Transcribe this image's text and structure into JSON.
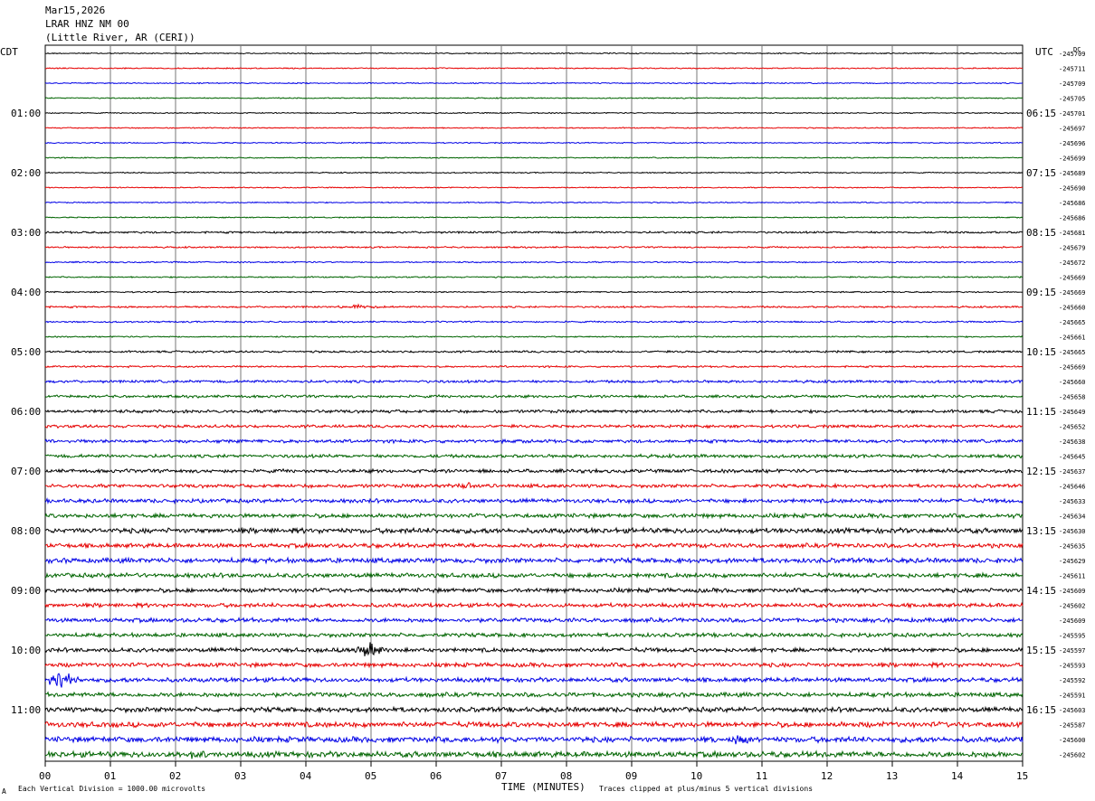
{
  "header": {
    "date": "Mar15,2026",
    "station": "LRAR HNZ NM 00",
    "location": "(Little River, AR (CERI))"
  },
  "axis": {
    "left_tz": "CDT",
    "right_tz": "UTC",
    "dc_label": "DC",
    "xlabel": "TIME (MINUTES)",
    "xticks": [
      "00",
      "01",
      "02",
      "03",
      "04",
      "05",
      "06",
      "07",
      "08",
      "09",
      "10",
      "11",
      "12",
      "13",
      "14",
      "15"
    ]
  },
  "footer": {
    "scale_note": "Each Vertical Division = 1000.00 microvolts",
    "clip_note": "Traces clipped at plus/minus 5 vertical divisions",
    "corner_mark": "A"
  },
  "chart_data": {
    "type": "line",
    "title": "",
    "xlabel": "TIME (MINUTES)",
    "ylabel": "",
    "xlim": [
      0,
      15
    ],
    "trace_colors": [
      "#000000",
      "#e60000",
      "#0000e6",
      "#006400"
    ],
    "rows_per_hour": 4,
    "left_hour_labels": [
      "01:00",
      "02:00",
      "03:00",
      "04:00",
      "05:00",
      "06:00",
      "07:00",
      "08:00",
      "09:00",
      "10:00",
      "11:00"
    ],
    "right_hour_labels": [
      "06:15",
      "07:15",
      "08:15",
      "09:15",
      "10:15",
      "11:15",
      "12:15",
      "13:15",
      "14:15",
      "15:15",
      "16:15"
    ],
    "dc_offsets": [
      -245709,
      -245711,
      -245709,
      -245705,
      -245701,
      -245697,
      -245696,
      -245699,
      -245689,
      -245690,
      -245686,
      -245686,
      -245681,
      -245679,
      -245672,
      -245669,
      -245669,
      -245660,
      -245665,
      -245661,
      -245665,
      -245669,
      -245660,
      -245658,
      -245649,
      -245652,
      -245638,
      -245645,
      -245637,
      -245646,
      -245633,
      -245634,
      -245630,
      -245635,
      -245629,
      -245611,
      -245609,
      -245602,
      -245609,
      -245595,
      -245597,
      -245593,
      -245592,
      -245591,
      -245603,
      -245587,
      -245600,
      -245602
    ],
    "row_noise": [
      0.5,
      0.5,
      0.5,
      0.5,
      0.5,
      0.5,
      0.5,
      0.5,
      0.5,
      0.5,
      0.5,
      0.5,
      0.9,
      0.7,
      0.6,
      0.6,
      0.6,
      0.8,
      0.7,
      0.6,
      0.9,
      0.8,
      1.2,
      1.2,
      1.4,
      1.3,
      1.5,
      1.5,
      1.6,
      1.6,
      1.8,
      1.9,
      2.3,
      2.0,
      2.2,
      2.0,
      1.9,
      1.8,
      1.9,
      1.8,
      1.9,
      1.9,
      2.0,
      2.0,
      2.2,
      2.4,
      2.5,
      2.6
    ],
    "events": [
      {
        "row": 17,
        "minute": 4.8,
        "amplitude": 3
      },
      {
        "row": 29,
        "minute": 6.5,
        "amplitude": 4
      },
      {
        "row": 40,
        "minute": 5.0,
        "amplitude": 12
      },
      {
        "row": 42,
        "minute": 0.25,
        "amplitude": 14
      },
      {
        "row": 46,
        "minute": 10.6,
        "amplitude": 6
      },
      {
        "row": 47,
        "minute": 2.3,
        "amplitude": 5
      }
    ]
  }
}
